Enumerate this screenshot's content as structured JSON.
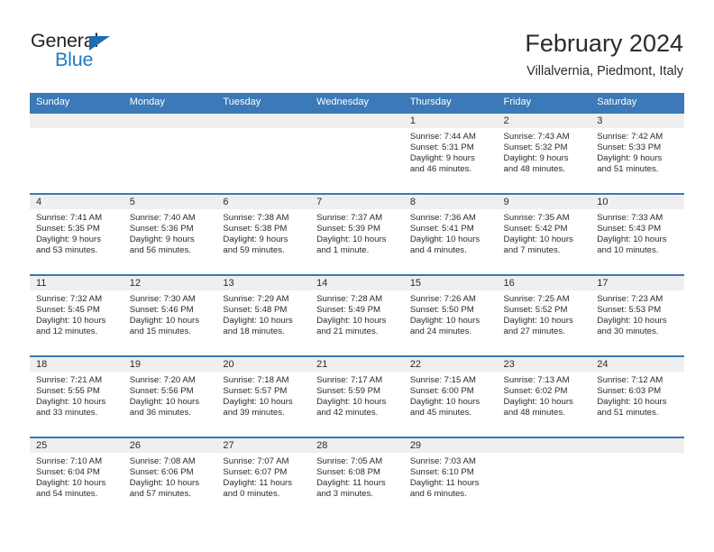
{
  "brand": {
    "name_top": "General",
    "name_bottom": "Blue",
    "triangle_color": "#1f6cb0",
    "blue_color": "#1f7ac4"
  },
  "header": {
    "title": "February 2024",
    "subtitle": "Villalvernia, Piedmont, Italy",
    "header_bg": "#3b79b8",
    "daynum_bg": "#efefef"
  },
  "weekday_headers": [
    "Sunday",
    "Monday",
    "Tuesday",
    "Wednesday",
    "Thursday",
    "Friday",
    "Saturday"
  ],
  "weeks": [
    [
      {
        "day": "",
        "lines": []
      },
      {
        "day": "",
        "lines": []
      },
      {
        "day": "",
        "lines": []
      },
      {
        "day": "",
        "lines": []
      },
      {
        "day": "1",
        "lines": [
          "Sunrise: 7:44 AM",
          "Sunset: 5:31 PM",
          "Daylight: 9 hours",
          "and 46 minutes."
        ]
      },
      {
        "day": "2",
        "lines": [
          "Sunrise: 7:43 AM",
          "Sunset: 5:32 PM",
          "Daylight: 9 hours",
          "and 48 minutes."
        ]
      },
      {
        "day": "3",
        "lines": [
          "Sunrise: 7:42 AM",
          "Sunset: 5:33 PM",
          "Daylight: 9 hours",
          "and 51 minutes."
        ]
      }
    ],
    [
      {
        "day": "4",
        "lines": [
          "Sunrise: 7:41 AM",
          "Sunset: 5:35 PM",
          "Daylight: 9 hours",
          "and 53 minutes."
        ]
      },
      {
        "day": "5",
        "lines": [
          "Sunrise: 7:40 AM",
          "Sunset: 5:36 PM",
          "Daylight: 9 hours",
          "and 56 minutes."
        ]
      },
      {
        "day": "6",
        "lines": [
          "Sunrise: 7:38 AM",
          "Sunset: 5:38 PM",
          "Daylight: 9 hours",
          "and 59 minutes."
        ]
      },
      {
        "day": "7",
        "lines": [
          "Sunrise: 7:37 AM",
          "Sunset: 5:39 PM",
          "Daylight: 10 hours",
          "and 1 minute."
        ]
      },
      {
        "day": "8",
        "lines": [
          "Sunrise: 7:36 AM",
          "Sunset: 5:41 PM",
          "Daylight: 10 hours",
          "and 4 minutes."
        ]
      },
      {
        "day": "9",
        "lines": [
          "Sunrise: 7:35 AM",
          "Sunset: 5:42 PM",
          "Daylight: 10 hours",
          "and 7 minutes."
        ]
      },
      {
        "day": "10",
        "lines": [
          "Sunrise: 7:33 AM",
          "Sunset: 5:43 PM",
          "Daylight: 10 hours",
          "and 10 minutes."
        ]
      }
    ],
    [
      {
        "day": "11",
        "lines": [
          "Sunrise: 7:32 AM",
          "Sunset: 5:45 PM",
          "Daylight: 10 hours",
          "and 12 minutes."
        ]
      },
      {
        "day": "12",
        "lines": [
          "Sunrise: 7:30 AM",
          "Sunset: 5:46 PM",
          "Daylight: 10 hours",
          "and 15 minutes."
        ]
      },
      {
        "day": "13",
        "lines": [
          "Sunrise: 7:29 AM",
          "Sunset: 5:48 PM",
          "Daylight: 10 hours",
          "and 18 minutes."
        ]
      },
      {
        "day": "14",
        "lines": [
          "Sunrise: 7:28 AM",
          "Sunset: 5:49 PM",
          "Daylight: 10 hours",
          "and 21 minutes."
        ]
      },
      {
        "day": "15",
        "lines": [
          "Sunrise: 7:26 AM",
          "Sunset: 5:50 PM",
          "Daylight: 10 hours",
          "and 24 minutes."
        ]
      },
      {
        "day": "16",
        "lines": [
          "Sunrise: 7:25 AM",
          "Sunset: 5:52 PM",
          "Daylight: 10 hours",
          "and 27 minutes."
        ]
      },
      {
        "day": "17",
        "lines": [
          "Sunrise: 7:23 AM",
          "Sunset: 5:53 PM",
          "Daylight: 10 hours",
          "and 30 minutes."
        ]
      }
    ],
    [
      {
        "day": "18",
        "lines": [
          "Sunrise: 7:21 AM",
          "Sunset: 5:55 PM",
          "Daylight: 10 hours",
          "and 33 minutes."
        ]
      },
      {
        "day": "19",
        "lines": [
          "Sunrise: 7:20 AM",
          "Sunset: 5:56 PM",
          "Daylight: 10 hours",
          "and 36 minutes."
        ]
      },
      {
        "day": "20",
        "lines": [
          "Sunrise: 7:18 AM",
          "Sunset: 5:57 PM",
          "Daylight: 10 hours",
          "and 39 minutes."
        ]
      },
      {
        "day": "21",
        "lines": [
          "Sunrise: 7:17 AM",
          "Sunset: 5:59 PM",
          "Daylight: 10 hours",
          "and 42 minutes."
        ]
      },
      {
        "day": "22",
        "lines": [
          "Sunrise: 7:15 AM",
          "Sunset: 6:00 PM",
          "Daylight: 10 hours",
          "and 45 minutes."
        ]
      },
      {
        "day": "23",
        "lines": [
          "Sunrise: 7:13 AM",
          "Sunset: 6:02 PM",
          "Daylight: 10 hours",
          "and 48 minutes."
        ]
      },
      {
        "day": "24",
        "lines": [
          "Sunrise: 7:12 AM",
          "Sunset: 6:03 PM",
          "Daylight: 10 hours",
          "and 51 minutes."
        ]
      }
    ],
    [
      {
        "day": "25",
        "lines": [
          "Sunrise: 7:10 AM",
          "Sunset: 6:04 PM",
          "Daylight: 10 hours",
          "and 54 minutes."
        ]
      },
      {
        "day": "26",
        "lines": [
          "Sunrise: 7:08 AM",
          "Sunset: 6:06 PM",
          "Daylight: 10 hours",
          "and 57 minutes."
        ]
      },
      {
        "day": "27",
        "lines": [
          "Sunrise: 7:07 AM",
          "Sunset: 6:07 PM",
          "Daylight: 11 hours",
          "and 0 minutes."
        ]
      },
      {
        "day": "28",
        "lines": [
          "Sunrise: 7:05 AM",
          "Sunset: 6:08 PM",
          "Daylight: 11 hours",
          "and 3 minutes."
        ]
      },
      {
        "day": "29",
        "lines": [
          "Sunrise: 7:03 AM",
          "Sunset: 6:10 PM",
          "Daylight: 11 hours",
          "and 6 minutes."
        ]
      },
      {
        "day": "",
        "lines": []
      },
      {
        "day": "",
        "lines": []
      }
    ]
  ]
}
